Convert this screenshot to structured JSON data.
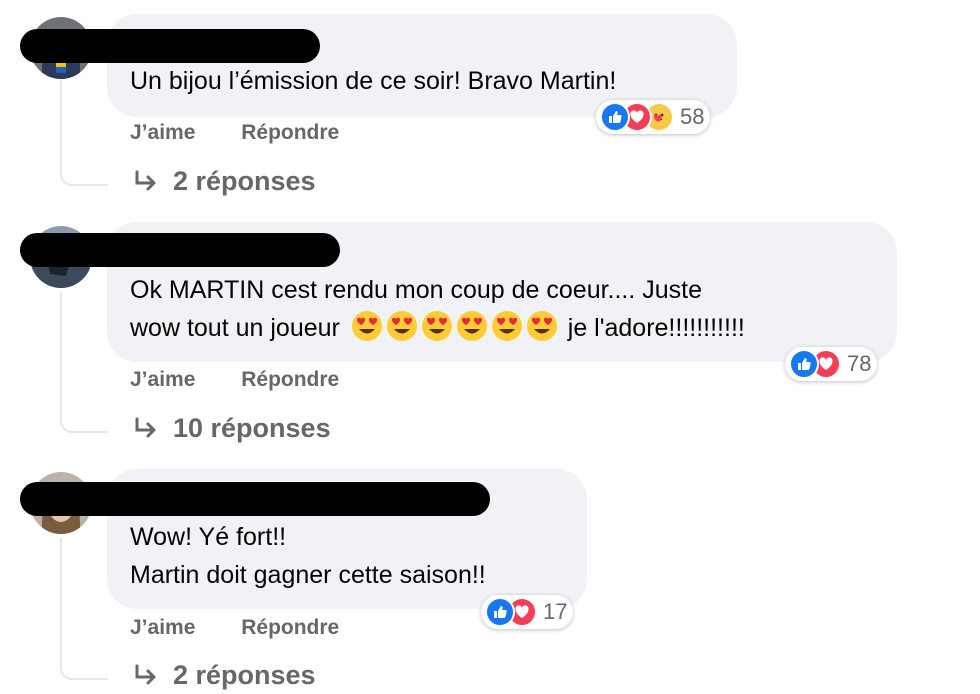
{
  "comments": [
    {
      "text_lines": [
        "Un bijou l’émission de ce soir! Bravo Martin!"
      ],
      "reaction_count": "58",
      "reactions": [
        "like-icon",
        "love-icon",
        "care-icon"
      ],
      "like_label": "J’aime",
      "reply_label": "Répondre",
      "replies_label": "2 réponses"
    },
    {
      "text_lines": [
        "Ok MARTIN cest rendu mon coup de coeur.... Juste",
        "wow tout un joueur",
        "je l'adore!!!!!!!!!!!"
      ],
      "emoji_count": 6,
      "emoji_name": "heart-eyes-emoji",
      "reaction_count": "78",
      "reactions": [
        "like-icon",
        "love-icon"
      ],
      "like_label": "J’aime",
      "reply_label": "Répondre",
      "replies_label": "10 réponses"
    },
    {
      "text_lines": [
        "Wow! Yé fort!!",
        "Martin doit gagner cette saison!!"
      ],
      "reaction_count": "17",
      "reactions": [
        "like-icon",
        "love-icon"
      ],
      "like_label": "J’aime",
      "reply_label": "Répondre",
      "replies_label": "2 réponses"
    }
  ],
  "colors": {
    "bubble": "#f0f2f5",
    "secondary_text": "#65676b",
    "like_blue": "#1877f2",
    "love_red": "#f33e58",
    "redaction": "#000000"
  }
}
